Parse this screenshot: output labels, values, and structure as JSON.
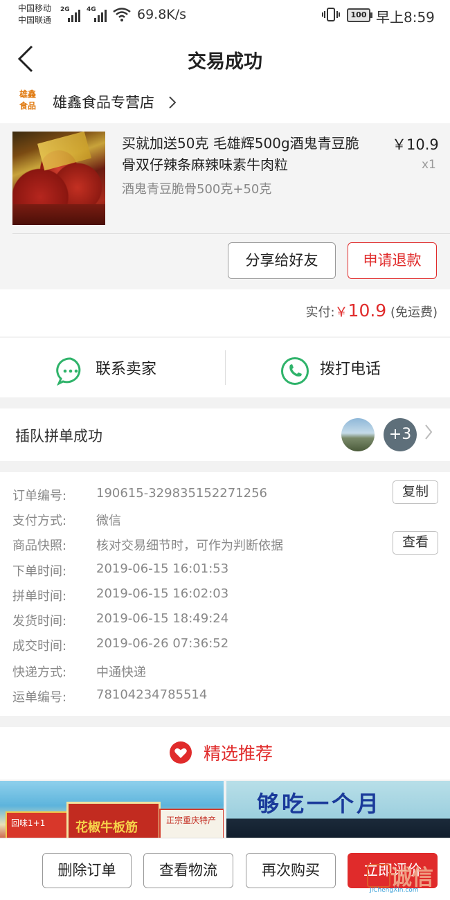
{
  "status_bar": {
    "carrier1": "中国移动",
    "carrier2": "中国联通",
    "net1": "2G",
    "net2": "4G",
    "speed": "69.8K/s",
    "battery": "100",
    "time": "早上8:59"
  },
  "header": {
    "title": "交易成功"
  },
  "shop": {
    "logo_line1": "雄鑫",
    "logo_line2": "食品",
    "name": "雄鑫食品专营店"
  },
  "product": {
    "name": "买就加送50克 毛雄辉500g酒鬼青豆脆骨双仔辣条麻辣味素牛肉粒",
    "price": "￥10.9",
    "qty": "x1",
    "sku": "酒鬼青豆脆骨500克+50克",
    "share_label": "分享给好友",
    "refund_label": "申请退款"
  },
  "payment": {
    "label": "实付:",
    "currency": "￥",
    "amount": "10.9",
    "note": "(免运费)"
  },
  "contact": {
    "seller_label": "联系卖家",
    "phone_label": "拨打电话"
  },
  "group": {
    "title": "插队拼单成功",
    "more_count": "+3"
  },
  "order_details": {
    "rows": [
      {
        "label": "订单编号:",
        "value": "190615-329835152271256"
      },
      {
        "label": "支付方式:",
        "value": "微信"
      },
      {
        "label": "商品快照:",
        "value": "核对交易细节时，可作为判断依据"
      },
      {
        "label": "下单时间:",
        "value": "2019-06-15 16:01:53"
      },
      {
        "label": "拼单时间:",
        "value": "2019-06-15 16:02:03"
      },
      {
        "label": "发货时间:",
        "value": "2019-06-15 18:49:24"
      },
      {
        "label": "成交时间:",
        "value": "2019-06-26 07:36:52"
      },
      {
        "label": "快递方式:",
        "value": "中通快递"
      },
      {
        "label": "运单编号:",
        "value": "78104234785514"
      }
    ],
    "copy_label": "复制",
    "view_label": "查看"
  },
  "recommend": {
    "title": "精选推荐",
    "img2_text": "够吃一个月",
    "pack1_text": "回味1+1",
    "pack2_text": "花椒牛板筋",
    "pack3_text": "正宗重庆特产"
  },
  "bottom_bar": {
    "delete_label": "删除订单",
    "logistics_label": "查看物流",
    "rebuy_label": "再次购买",
    "review_label": "立即评价"
  },
  "watermark": {
    "text": "诚信",
    "sub": "JiChengXin.com"
  },
  "colors": {
    "accent": "#e02b2b",
    "green": "#2fb36a",
    "logo_orange": "#e07a10"
  }
}
